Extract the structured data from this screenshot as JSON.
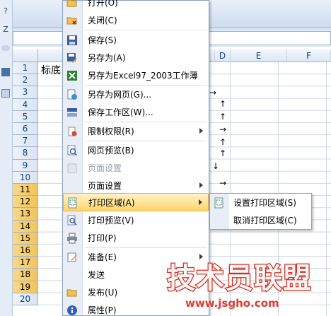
{
  "spreadsheet": {
    "columns": [
      "D",
      "E",
      "F"
    ],
    "rows": [
      "1",
      "2",
      "3",
      "4",
      "5",
      "6",
      "7",
      "8",
      "9",
      "10",
      "11",
      "12",
      "13",
      "14",
      "15",
      "16",
      "17",
      "18",
      "19",
      "20"
    ],
    "selected_rows": [
      "11",
      "12",
      "13",
      "14",
      "15",
      "16",
      "17",
      "18",
      "19"
    ],
    "cell_a1_visible_text": "标底",
    "left_toolbar_glyphs": [
      "?",
      "Z"
    ]
  },
  "office_menu": {
    "items": [
      {
        "label": "打开(O)",
        "icon": "open-folder-icon"
      },
      {
        "label": "关闭(C)",
        "icon": "close-folder-icon"
      },
      {
        "label": "保存(S)",
        "icon": "save-disk-icon"
      },
      {
        "label": "另存为(A)",
        "icon": "save-as-icon"
      },
      {
        "label": "另存为Excel97_2003工作薄",
        "icon": "excel-save-icon"
      },
      {
        "label": "另存为网页(G)...",
        "icon": "web-page-icon"
      },
      {
        "label": "保存工作区(W)...",
        "icon": "workspace-icon"
      },
      {
        "label": "限制权限(R)",
        "icon": "permission-icon",
        "has_submenu": true
      },
      {
        "label": "网页预览(B)",
        "icon": "web-preview-icon"
      },
      {
        "label": "页面设置",
        "icon": "page-setup-icon",
        "disabled": true
      },
      {
        "label": "页面设置",
        "icon": "",
        "has_submenu": true
      },
      {
        "label": "打印区域(A)",
        "icon": "print-area-icon",
        "has_submenu": true,
        "highlighted": true
      },
      {
        "label": "打印预览(V)",
        "icon": "print-preview-icon"
      },
      {
        "label": "打印(P)",
        "icon": "printer-icon"
      },
      {
        "label": "准备(E)",
        "icon": "prepare-icon",
        "has_submenu": true
      },
      {
        "label": "发送",
        "icon": ""
      },
      {
        "label": "发布(U)",
        "icon": "publish-icon"
      },
      {
        "label": "属性(P)",
        "icon": "properties-icon"
      }
    ]
  },
  "print_area_submenu": {
    "items": [
      {
        "label": "设置打印区域(S)",
        "icon": "set-print-area-icon"
      },
      {
        "label": "取消打印区域(C)",
        "icon": ""
      }
    ]
  },
  "watermark": {
    "title": "技术员联盟",
    "url": "www.jsgho.com"
  },
  "colors": {
    "menu_highlight": "#ffd56b",
    "watermark_red": "#d9291c",
    "header_blue": "#15428b"
  }
}
